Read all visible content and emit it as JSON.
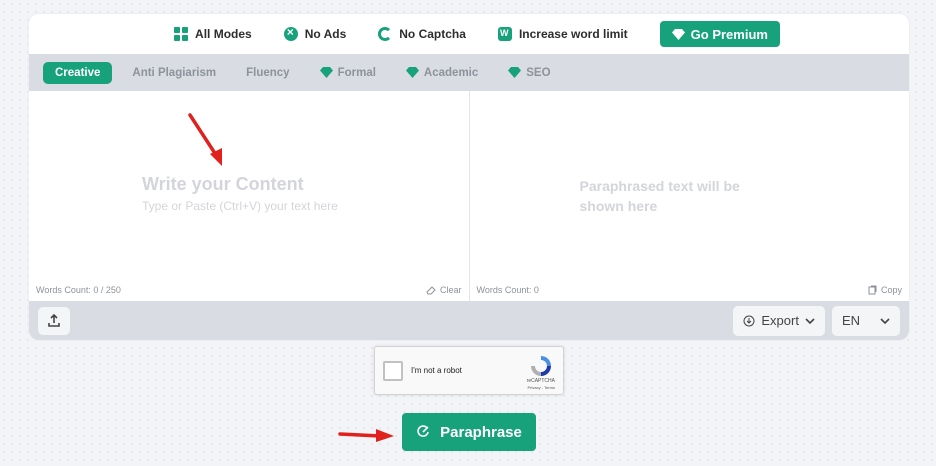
{
  "features": {
    "all_modes": "All Modes",
    "no_ads": "No Ads",
    "no_captcha": "No Captcha",
    "word_limit": "Increase word limit",
    "premium": "Go Premium"
  },
  "modes": [
    {
      "label": "Creative",
      "active": true,
      "premium": false
    },
    {
      "label": "Anti Plagiarism",
      "premium": false
    },
    {
      "label": "Fluency",
      "premium": false
    },
    {
      "label": "Formal",
      "premium": true
    },
    {
      "label": "Academic",
      "premium": true
    },
    {
      "label": "SEO",
      "premium": true
    }
  ],
  "input": {
    "title": "Write your Content",
    "subtitle": "Type or Paste (Ctrl+V) your text here",
    "words_label": "Words Count:",
    "words_value": "0 / 250",
    "clear": "Clear"
  },
  "output": {
    "placeholder": "Paraphrased text will be shown here",
    "words_label": "Words Count:",
    "words_value": "0",
    "copy": "Copy"
  },
  "toolbar": {
    "export": "Export",
    "language": "EN"
  },
  "captcha": {
    "label": "I'm not a robot",
    "brand": "reCAPTCHA",
    "terms": "Privacy - Terms"
  },
  "action": {
    "paraphrase": "Paraphrase"
  },
  "colors": {
    "accent": "#17a27c",
    "annotation_arrow": "#e0211d"
  }
}
